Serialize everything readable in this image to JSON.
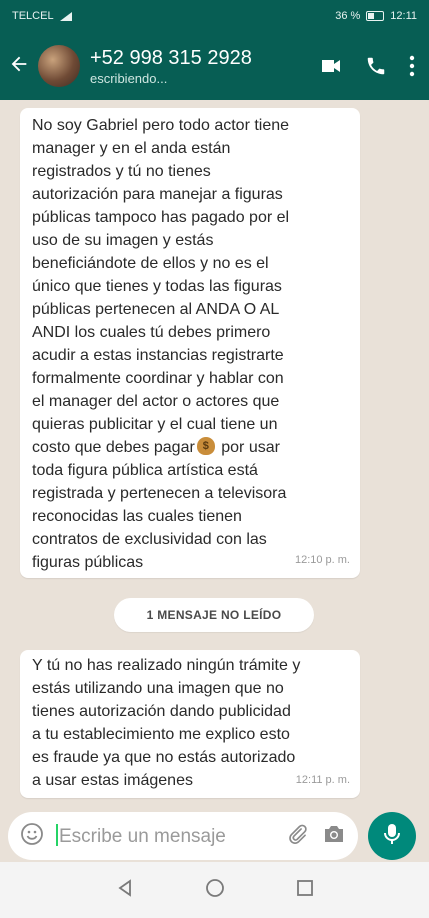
{
  "status_bar": {
    "carrier": "TELCEL",
    "battery": "36 %",
    "time": "12:11"
  },
  "header": {
    "contact_name": "+52 998 315 2928",
    "presence": "escribiendo..."
  },
  "messages": [
    {
      "text": "No soy Gabriel pero todo actor tiene\nmanager y en el anda están\nregistrados y tú no tienes\nautorización para manejar a figuras\npúblicas tampoco has pagado por el\nuso de su imagen y estás\nbeneficiándote de ellos y no es el\núnico que tienes y todas las figuras\npúblicas pertenecen al ANDA O  AL\nANDI los cuales tú debes primero\nacudir a estas instancias registrarte\nformalmente coordinar y hablar con\nel manager del actor o actores que\nquieras publicitar y el cual tiene un\ncosto que debes pagar",
      "text_after_emoji": " por usar\ntoda figura pública artística está\nregistrada y pertenecen a televisora\nreconocidas las cuales tienen\ncontratos de exclusividad con las\nfiguras públicas",
      "time": "12:10 p. m."
    },
    {
      "text": "Y tú no has realizado ningún trámite y\nestás utilizando una imagen que no\ntienes autorización dando publicidad\na tu establecimiento me explico esto\nes fraude ya que no estás autorizado\na usar estas imágenes",
      "time": "12:11 p. m."
    }
  ],
  "unread_banner": "1 MENSAJE NO LEÍDO",
  "input": {
    "placeholder": "Escribe un mensaje"
  },
  "colors": {
    "header": "#075e54",
    "mic_button": "#00897b",
    "chat_bg": "#e9e1d8"
  }
}
